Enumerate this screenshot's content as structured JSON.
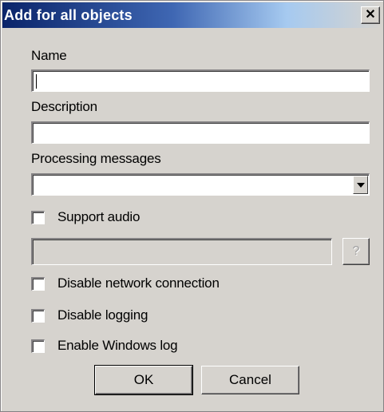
{
  "dialog": {
    "title": "Add for all objects",
    "close_glyph": "✕"
  },
  "form": {
    "name_label": "Name",
    "name_value": "",
    "description_label": "Description",
    "description_value": "",
    "processing_label": "Processing messages",
    "processing_value": "",
    "support_audio_label": "Support audio",
    "support_audio_checked": false,
    "audio_path_value": "",
    "help_button_label": "?",
    "disable_network_label": "Disable network connection",
    "disable_network_checked": false,
    "disable_logging_label": "Disable logging",
    "disable_logging_checked": false,
    "enable_windows_log_label": "Enable Windows log",
    "enable_windows_log_checked": false
  },
  "buttons": {
    "ok_label": "OK",
    "cancel_label": "Cancel"
  },
  "colors": {
    "title_gradient_start": "#0a246a",
    "dialog_background": "#d6d3ce"
  }
}
